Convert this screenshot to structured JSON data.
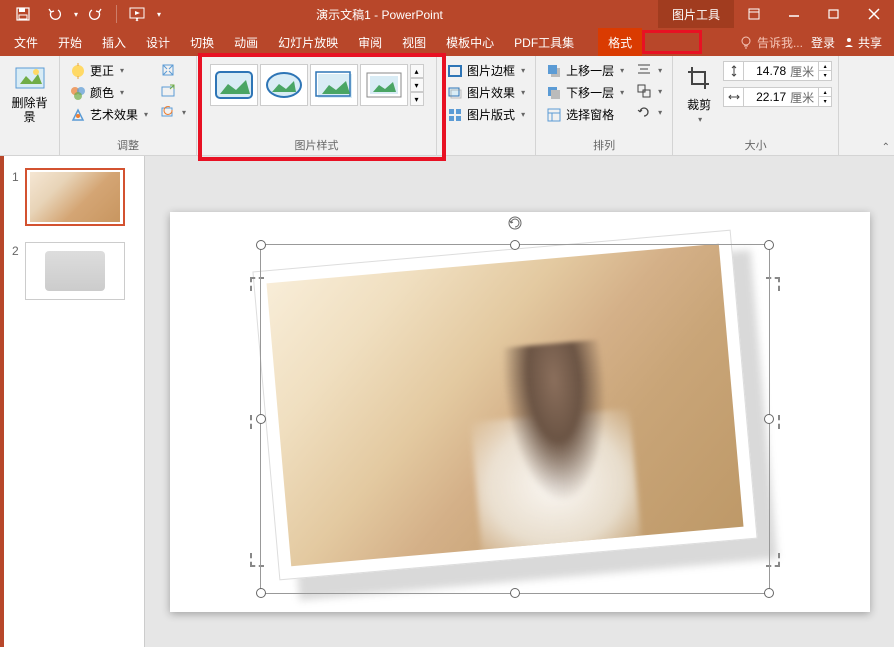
{
  "title": "演示文稿1 - PowerPoint",
  "tool_tab": "图片工具",
  "menu": {
    "file": "文件",
    "home": "开始",
    "insert": "插入",
    "design": "设计",
    "transitions": "切换",
    "animations": "动画",
    "slideshow": "幻灯片放映",
    "review": "审阅",
    "view": "视图",
    "templates": "模板中心",
    "pdf": "PDF工具集",
    "format": "格式"
  },
  "tell_me": "告诉我...",
  "login": "登录",
  "share": "共享",
  "ribbon": {
    "remove_bg": "删除背景",
    "corrections": "更正",
    "color": "颜色",
    "artistic": "艺术效果",
    "adjust_label": "调整",
    "styles_label": "图片样式",
    "border": "图片边框",
    "effects": "图片效果",
    "layout": "图片版式",
    "bring_forward": "上移一层",
    "send_backward": "下移一层",
    "selection_pane": "选择窗格",
    "arrange_label": "排列",
    "crop": "裁剪",
    "height": "14.78",
    "width": "22.17",
    "unit": "厘米",
    "size_label": "大小"
  },
  "slides": {
    "n1": "1",
    "n2": "2"
  }
}
